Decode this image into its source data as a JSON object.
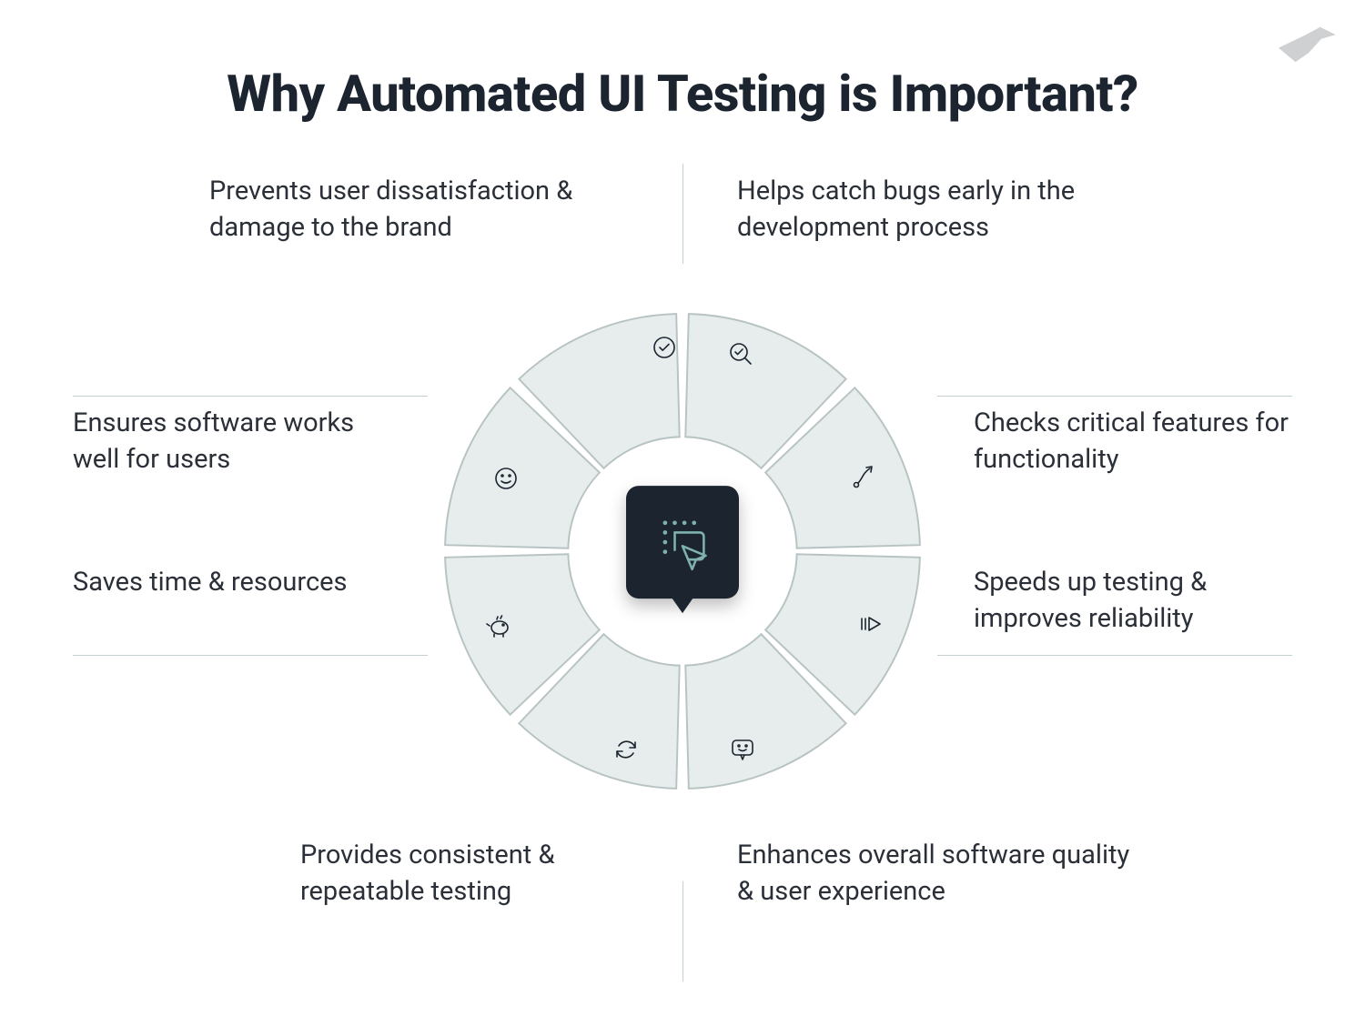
{
  "title": "Why Automated UI Testing is Important?",
  "segments": {
    "top_left": {
      "label": "Prevents user dissatisfaction & damage to the brand",
      "icon": "check-circle-icon"
    },
    "top_right": {
      "label": "Helps catch bugs early in the development process",
      "icon": "search-check-icon"
    },
    "right_upper": {
      "label": "Checks critical features for functionality",
      "icon": "path-arrow-icon"
    },
    "right_lower": {
      "label": "Speeds up testing & improves reliability",
      "icon": "fast-forward-icon"
    },
    "bottom_right": {
      "label": "Enhances overall software quality & user experience",
      "icon": "chat-smile-icon"
    },
    "bottom_left": {
      "label": "Provides consistent & repeatable testing",
      "icon": "refresh-icon"
    },
    "left_lower": {
      "label": "Saves time & resources",
      "icon": "piggy-bank-icon"
    },
    "left_upper": {
      "label": "Ensures software works well for users",
      "icon": "smile-face-icon"
    }
  },
  "center_icon": "cursor-click-icon",
  "logo_icon": "bird-icon",
  "colors": {
    "segment_fill": "#e6edec",
    "segment_stroke": "#b7c3c2",
    "text": "#2a2f38",
    "title": "#1c2430",
    "center_bg": "#1c2430",
    "center_accent": "#7fb2ac",
    "line": "#c4cfd2"
  }
}
